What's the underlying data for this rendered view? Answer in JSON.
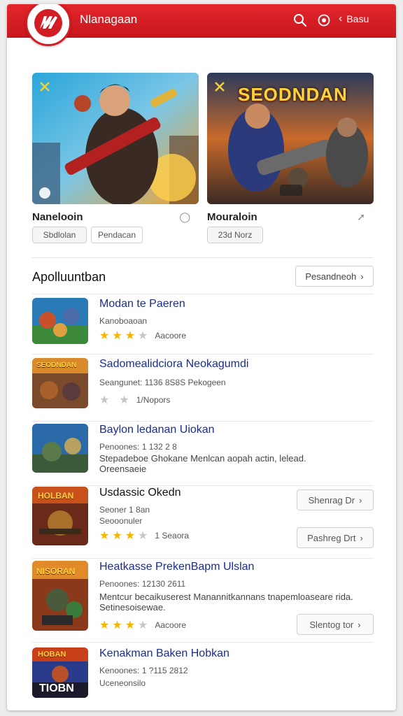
{
  "header": {
    "title": "Nlanagaan",
    "back_label": "Basu"
  },
  "featured": [
    {
      "name": "Nanelooin",
      "badge": "",
      "chips": [
        "Sbdlolan",
        "Pendacan"
      ]
    },
    {
      "name": "Mouraloin",
      "badge": "SEODNDAN",
      "chips": [
        "23d Norz"
      ]
    }
  ],
  "section": {
    "title": "Apolluuntban",
    "button_label": "Pesandneoh"
  },
  "list": [
    {
      "title": "Modan te Paeren",
      "subtitle": "Kanoboaoan",
      "rating": 3,
      "rating_label": "Aacoore"
    },
    {
      "title": "Sadomealidciora Neokagumdi",
      "subtitle": "Seangunet: 1136 8S8S  Pekogeen",
      "thumb_text": "SEODNDAN",
      "rating": 0,
      "rating_label": "1/Nopors"
    },
    {
      "title": "Baylon ledanan Uiokan",
      "subtitle": "Penoones: 1 132 2 8",
      "description": "Stepadeboe Ghokane Menlcan aopah actin, lelead. Oreensaeie"
    },
    {
      "title": "Usdassic Okedn",
      "subtitle": "Seoner 1 8an",
      "subtitle2": "Seooonuler",
      "thumb_text": "HOLBAN",
      "rating": 3,
      "rating_label": "1 Seaora",
      "action_top": "Shenrag Dr",
      "action_bottom": "Pashreg Drt"
    },
    {
      "title": "Heatkasse PrekenBapm Ulslan",
      "subtitle": "Penoones: 12130 2611",
      "description": "Mentcur becaikuserest Manannitkannans tnapemloaseare rida. Setinesoisewae.",
      "thumb_text": "NISORAN",
      "rating": 3,
      "rating_label": "Aacoore",
      "action_bottom": "Slentog tor"
    },
    {
      "title": "Kenakman Baken Hobkan",
      "subtitle": "Kenoones: 1 ?115 2812",
      "subtitle2": "Uceneonsilo",
      "thumb_text": "HOBAN",
      "thumb_text2": "TIOBN"
    }
  ],
  "colors": {
    "brand_red": "#d31d24",
    "link_blue": "#1b2d8f",
    "star": "#f5b400"
  }
}
